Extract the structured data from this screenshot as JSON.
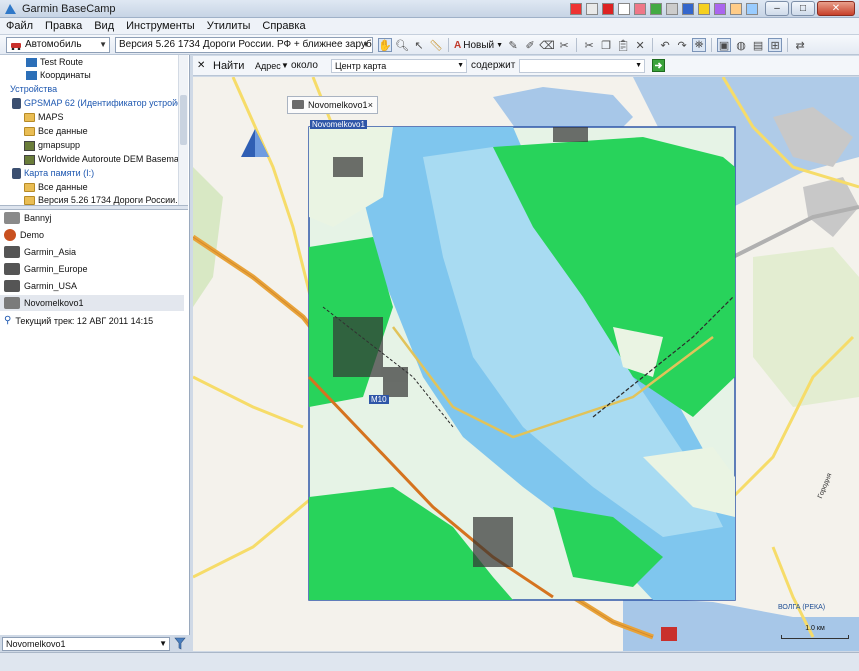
{
  "window": {
    "title": "Garmin BaseCamp"
  },
  "menu": [
    "Файл",
    "Правка",
    "Вид",
    "Инструменты",
    "Утилиты",
    "Справка"
  ],
  "toolbar": {
    "profile": "Автомобиль",
    "map_product": "Версия 5.26  1734 Дороги России. РФ + ближнее зарубежье.",
    "new_label": "Новый"
  },
  "tree": {
    "items": [
      {
        "label": "Test Route",
        "icon": "route-icon"
      },
      {
        "label": "Координаты",
        "icon": "route-icon"
      },
      {
        "label": "Устройства",
        "icon": ""
      },
      {
        "label": "GPSMAP 62 (Идентификатор устройств",
        "icon": "device-icon"
      },
      {
        "label": "MAPS",
        "icon": "folder-icon"
      },
      {
        "label": "Все данные",
        "icon": "folder-icon"
      },
      {
        "label": "gmapsupp",
        "icon": "map-icon"
      },
      {
        "label": "Worldwide Autoroute DEM Basemap.N",
        "icon": "map-icon"
      },
      {
        "label": "Карта памяти (I:)",
        "icon": "device-icon"
      },
      {
        "label": "Все данные",
        "icon": "folder-icon"
      },
      {
        "label": "Версия 5.26  1734 Дороги России. Р",
        "icon": "map-icon"
      }
    ]
  },
  "library": {
    "items": [
      {
        "label": "Bannyj"
      },
      {
        "label": "Demo"
      },
      {
        "label": "Garmin_Asia"
      },
      {
        "label": "Garmin_Europe"
      },
      {
        "label": "Garmin_USA"
      },
      {
        "label": "Novomelkovo1"
      },
      {
        "label": "Текущий трек: 12 АВГ 2011 14:15"
      }
    ],
    "selected": "Novomelkovo1"
  },
  "bottom_combo": "Novomelkovo1",
  "search": {
    "find": "Найти",
    "address": "Адрес",
    "near": "около",
    "center": "Центр карта",
    "contains": "содержит"
  },
  "map": {
    "tab_label": "Novomelkovo1",
    "overlay_label": "Novomelkovo1",
    "road_label": "M10",
    "river_label": "ВОЛГА (РЕКА)",
    "city_label": "Городня",
    "town_label": "Городня",
    "scale_label": "1.0 км",
    "colors": {
      "background": "#f4f2ec",
      "major_road": "#e8a33a",
      "minor_road": "#f6dc69",
      "water": "#a7c7e8",
      "forest": "#28d35b",
      "overlay_border": "#2f56a8"
    }
  }
}
